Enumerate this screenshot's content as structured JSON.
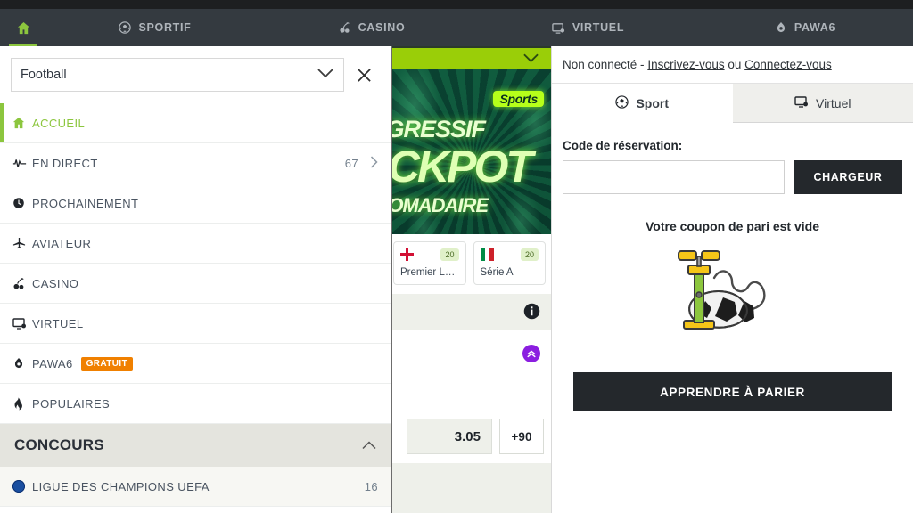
{
  "topnav": {
    "home_icon": "home-icon",
    "items": [
      {
        "label": "SPORTIF",
        "icon": "soccer-ball-icon"
      },
      {
        "label": "CASINO",
        "icon": "cherries-icon"
      },
      {
        "label": "VIRTUEL",
        "icon": "monitor-icon"
      },
      {
        "label": "PAWA6",
        "icon": "droplet-six-icon"
      }
    ]
  },
  "sidebar": {
    "sport_select_value": "Football",
    "chevron_icon": "chevron-down-icon",
    "close_icon": "close-icon",
    "items": [
      {
        "label": "ACCUEIL",
        "icon": "home-icon",
        "active": true,
        "count": "",
        "arrow": false,
        "badge": ""
      },
      {
        "label": "EN DIRECT",
        "icon": "pulse-icon",
        "active": false,
        "count": "67",
        "arrow": true,
        "badge": ""
      },
      {
        "label": "PROCHAINEMENT",
        "icon": "clock-icon",
        "active": false,
        "count": "",
        "arrow": false,
        "badge": ""
      },
      {
        "label": "AVIATEUR",
        "icon": "plane-icon",
        "active": false,
        "count": "",
        "arrow": false,
        "badge": ""
      },
      {
        "label": "CASINO",
        "icon": "cherries-icon",
        "active": false,
        "count": "",
        "arrow": false,
        "badge": ""
      },
      {
        "label": "VIRTUEL",
        "icon": "monitor-icon",
        "active": false,
        "count": "",
        "arrow": false,
        "badge": ""
      },
      {
        "label": "PAWA6",
        "icon": "droplet-six-icon",
        "active": false,
        "count": "",
        "arrow": false,
        "badge": "GRATUIT"
      },
      {
        "label": "POPULAIRES",
        "icon": "flame-icon",
        "active": false,
        "count": "",
        "arrow": false,
        "badge": ""
      }
    ],
    "section": {
      "title": "CONCOURS",
      "collapse_icon": "chevron-up-icon"
    },
    "competitions": [
      {
        "label": "LIGUE DES CHAMPIONS UEFA",
        "count": "16",
        "icon": "uefa-ball-icon"
      }
    ]
  },
  "middle": {
    "promo": {
      "chevron_icon": "chevron-down-icon",
      "badge": "Sports",
      "line1": "PROGRESSIF",
      "line2": "JACKPOT",
      "line3": "HEBDOMADAIRE"
    },
    "leagues": [
      {
        "name": "Premier Leag...",
        "count": "20",
        "flag": "england-flag-icon"
      },
      {
        "name": "Série A",
        "count": "20",
        "flag": "italy-flag-icon"
      }
    ],
    "info_icon": "info-icon",
    "boost_icon": "double-chevron-up-icon",
    "odds": [
      {
        "value": "3.05"
      }
    ],
    "more_markets": "+90"
  },
  "betslip": {
    "auth": {
      "status": "Non connecté -",
      "register": "Inscrivez-vous",
      "separator": "ou",
      "login": "Connectez-vous"
    },
    "tabs": [
      {
        "label": "Sport",
        "icon": "soccer-ball-icon",
        "active": true
      },
      {
        "label": "Virtuel",
        "icon": "monitor-icon",
        "active": false
      }
    ],
    "reservation_label": "Code de réservation:",
    "reservation_value": "",
    "reservation_placeholder": "",
    "load_button": "CHARGEUR",
    "empty_message": "Votre coupon de pari est vide",
    "empty_art_icon": "deflated-ball-pump-icon",
    "cta_button": "APPRENDRE À PARIER"
  },
  "colors": {
    "accent_green": "#8cc63e",
    "nav_bg": "#343a40",
    "dark_button": "#24282c",
    "orange_badge": "#f08000",
    "promo_green": "#9ace08",
    "boost_purple": "#8b1ee0"
  }
}
